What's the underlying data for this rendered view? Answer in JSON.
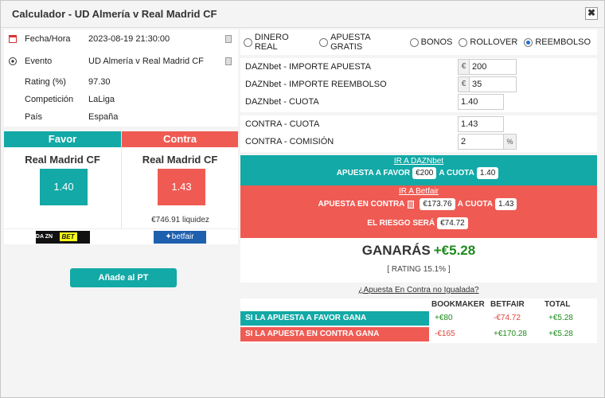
{
  "window": {
    "title": "Calculador - UD Almería v Real Madrid CF",
    "close_label": "✖"
  },
  "event_info": [
    {
      "label": "Fecha/Hora",
      "value": "2023-08-19 21:30:00",
      "icon": "calendar-icon"
    },
    {
      "label": "Evento",
      "value": "UD Almería v Real Madrid CF",
      "icon": "football-icon"
    },
    {
      "label": "Rating (%)",
      "value": "97.30"
    },
    {
      "label": "Competición",
      "value": "LaLiga"
    },
    {
      "label": "País",
      "value": "España"
    }
  ],
  "favor": {
    "header": "Favor",
    "team": "Real Madrid CF",
    "odds": "1.40",
    "color": "#12a9a6",
    "logo_text": "DA ZN",
    "logo_bet": "BET"
  },
  "contra": {
    "header": "Contra",
    "team": "Real Madrid CF",
    "odds": "1.43",
    "liquidity": "€746.91 liquidez",
    "color": "#ef5b53",
    "logo_text": "✦betfair"
  },
  "add_button": "Añade al PT",
  "bet_types": [
    {
      "label": "DINERO REAL",
      "selected": false
    },
    {
      "label": "APUESTA GRATIS",
      "selected": false
    },
    {
      "label": "BONOS",
      "selected": false
    },
    {
      "label": "ROLLOVER",
      "selected": false
    },
    {
      "label": "REEMBOLSO",
      "selected": true
    }
  ],
  "fields": {
    "importe_apuesta": {
      "label": "DAZNbet - IMPORTE APUESTA",
      "prefix": "€",
      "value": "200"
    },
    "importe_reembolso": {
      "label": "DAZNbet - IMPORTE REEMBOLSO",
      "prefix": "€",
      "value": "35"
    },
    "cuota": {
      "label": "DAZNbet - CUOTA",
      "value": "1.40"
    },
    "contra_cuota": {
      "label": "CONTRA - CUOTA",
      "value": "1.43"
    },
    "contra_comision": {
      "label": "CONTRA - COMISIÓN",
      "value": "2",
      "suffix": "%"
    }
  },
  "dazn_band": {
    "link": "IR A DAZNbet",
    "favor_label": "APUESTA A FAVOR",
    "stake": "€200",
    "cuota_label": "A CUOTA",
    "cuota": "1.40"
  },
  "betfair_band": {
    "link": "IR A Betfair",
    "contra_label": "APUESTA EN CONTRA",
    "stake": "€173.76",
    "cuota_label": "A CUOTA",
    "cuota": "1.43",
    "risk_label": "EL RIESGO SERÁ",
    "risk": "€74.72"
  },
  "result": {
    "label": "GANARÁS",
    "amount": "+€5.28",
    "rating": "[ RATING 15.1% ]"
  },
  "unmatched_link": "¿Apuesta En Contra no Igualada?",
  "table": {
    "headers": [
      "BOOKMAKER",
      "BETFAIR",
      "TOTAL"
    ],
    "rows": [
      {
        "label": "SI LA APUESTA A FAVOR GANA",
        "bookmaker": "+€80",
        "betfair": "-€74.72",
        "total": "+€5.28"
      },
      {
        "label": "SI LA APUESTA EN CONTRA GANA",
        "bookmaker": "-€165",
        "betfair": "+€170.28",
        "total": "+€5.28"
      }
    ]
  }
}
